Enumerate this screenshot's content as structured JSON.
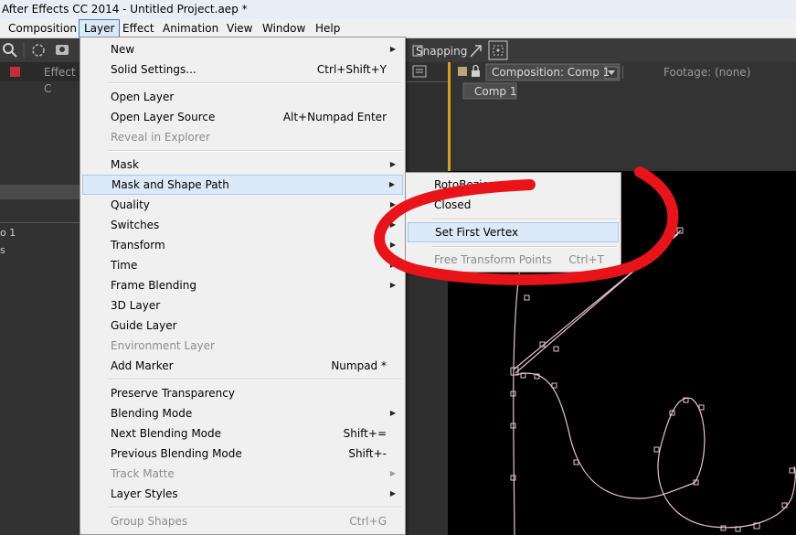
{
  "window": {
    "title": "After Effects CC 2014 - Untitled Project.aep *"
  },
  "menubar": {
    "items": [
      "Composition",
      "Layer",
      "Effect",
      "Animation",
      "View",
      "Window",
      "Help"
    ],
    "active": "Layer"
  },
  "toolbar": {
    "snapping_label": "Snapping"
  },
  "left_panel": {
    "tab_label": "Effect C",
    "item1": "o 1",
    "item2": "s"
  },
  "comp_panel": {
    "comp_tab": "Composition: Comp 1",
    "footage_tab": "Footage: (none)",
    "breadcrumb": "Comp 1"
  },
  "layer_menu": {
    "items": [
      {
        "label": "New",
        "shortcut": "",
        "submenu": true,
        "disabled": false
      },
      {
        "label": "Solid Settings...",
        "shortcut": "Ctrl+Shift+Y",
        "submenu": false,
        "disabled": false
      },
      {
        "label": "Open Layer",
        "shortcut": "",
        "submenu": false,
        "disabled": false
      },
      {
        "label": "Open Layer Source",
        "shortcut": "Alt+Numpad Enter",
        "submenu": false,
        "disabled": false
      },
      {
        "label": "Reveal in Explorer",
        "shortcut": "",
        "submenu": false,
        "disabled": true
      },
      {
        "label": "Mask",
        "shortcut": "",
        "submenu": true,
        "disabled": false
      },
      {
        "label": "Mask and Shape Path",
        "shortcut": "",
        "submenu": true,
        "disabled": false,
        "highlighted": true
      },
      {
        "label": "Quality",
        "shortcut": "",
        "submenu": true,
        "disabled": false
      },
      {
        "label": "Switches",
        "shortcut": "",
        "submenu": true,
        "disabled": false
      },
      {
        "label": "Transform",
        "shortcut": "",
        "submenu": true,
        "disabled": false
      },
      {
        "label": "Time",
        "shortcut": "",
        "submenu": true,
        "disabled": false
      },
      {
        "label": "Frame Blending",
        "shortcut": "",
        "submenu": true,
        "disabled": false
      },
      {
        "label": "3D Layer",
        "shortcut": "",
        "submenu": false,
        "disabled": false
      },
      {
        "label": "Guide Layer",
        "shortcut": "",
        "submenu": false,
        "disabled": false
      },
      {
        "label": "Environment Layer",
        "shortcut": "",
        "submenu": false,
        "disabled": true
      },
      {
        "label": "Add Marker",
        "shortcut": "Numpad *",
        "submenu": false,
        "disabled": false
      },
      {
        "label": "Preserve Transparency",
        "shortcut": "",
        "submenu": false,
        "disabled": false
      },
      {
        "label": "Blending Mode",
        "shortcut": "",
        "submenu": true,
        "disabled": false
      },
      {
        "label": "Next Blending Mode",
        "shortcut": "Shift+=",
        "submenu": false,
        "disabled": false
      },
      {
        "label": "Previous Blending Mode",
        "shortcut": "Shift+-",
        "submenu": false,
        "disabled": false
      },
      {
        "label": "Track Matte",
        "shortcut": "",
        "submenu": true,
        "disabled": true
      },
      {
        "label": "Layer Styles",
        "shortcut": "",
        "submenu": true,
        "disabled": false
      },
      {
        "label": "Group Shapes",
        "shortcut": "Ctrl+G",
        "submenu": false,
        "disabled": true
      }
    ]
  },
  "mask_shape_submenu": {
    "items": [
      {
        "label": "RotoBezier",
        "shortcut": "",
        "disabled": false
      },
      {
        "label": "Closed",
        "shortcut": "",
        "disabled": false
      },
      {
        "label": "Set First Vertex",
        "shortcut": "",
        "disabled": false,
        "highlighted": true
      },
      {
        "label": "Free Transform Points",
        "shortcut": "Ctrl+T",
        "disabled": true
      }
    ]
  },
  "annotation": {
    "color": "#e8141a"
  },
  "colors": {
    "mask_path": "#e9c3cd",
    "viewer_bg": "#000000",
    "accent": "#3d7bc2"
  }
}
